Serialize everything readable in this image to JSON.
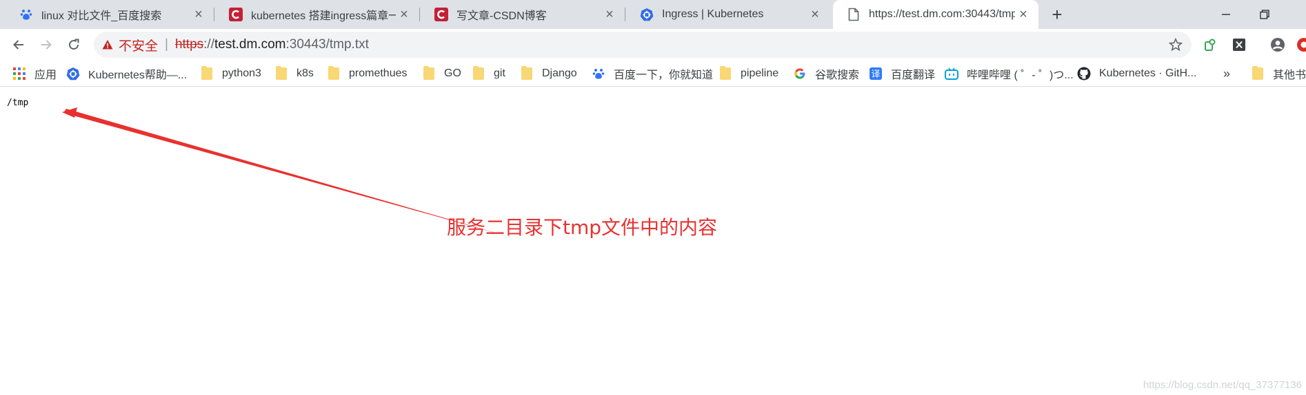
{
  "tabs": [
    {
      "title": "linux 对比文件_百度搜索",
      "icon": "baidu-paw-icon"
    },
    {
      "title": "kubernetes 搭建ingress篇章一_",
      "icon": "csdn-logo-icon"
    },
    {
      "title": "写文章-CSDN博客",
      "icon": "csdn-logo-icon"
    },
    {
      "title": "Ingress | Kubernetes",
      "icon": "kubernetes-logo-icon"
    },
    {
      "title": "https://test.dm.com:30443/tmp",
      "icon": "page-icon"
    }
  ],
  "address_bar": {
    "security_label": "不安全",
    "divider": "|",
    "scheme": "https",
    "separator": "://",
    "host": "test.dm.com",
    "path": ":30443/tmp.txt"
  },
  "bookmarks": [
    {
      "label": "应用",
      "icon": "apps-grid-icon"
    },
    {
      "label": "Kubernetes帮助—...",
      "icon": "kubernetes-logo-icon"
    },
    {
      "label": "python3",
      "icon": "folder-icon"
    },
    {
      "label": "k8s",
      "icon": "folder-icon"
    },
    {
      "label": "promethues",
      "icon": "folder-icon"
    },
    {
      "label": "GO",
      "icon": "folder-icon"
    },
    {
      "label": "git",
      "icon": "folder-icon"
    },
    {
      "label": "Django",
      "icon": "folder-icon"
    },
    {
      "label": "百度一下，你就知道",
      "icon": "baidu-paw-icon"
    },
    {
      "label": "pipeline",
      "icon": "folder-icon"
    },
    {
      "label": "谷歌搜索",
      "icon": "google-g-icon"
    },
    {
      "label": "百度翻译",
      "icon": "translate-icon"
    },
    {
      "label": "哔哩哔哩 ( ゜- ゜)つ...",
      "icon": "bilibili-tv-icon"
    },
    {
      "label": "Kubernetes · GitH...",
      "icon": "github-logo-icon"
    }
  ],
  "bookmarks_overflow": "»",
  "other_bookmarks": "其他书签",
  "page": {
    "file_content": "/tmp"
  },
  "annotation": {
    "text": "服务二目录下tmp文件中的内容",
    "color": "#e8312f"
  },
  "watermark": "https://blog.csdn.net/qq_37377136"
}
